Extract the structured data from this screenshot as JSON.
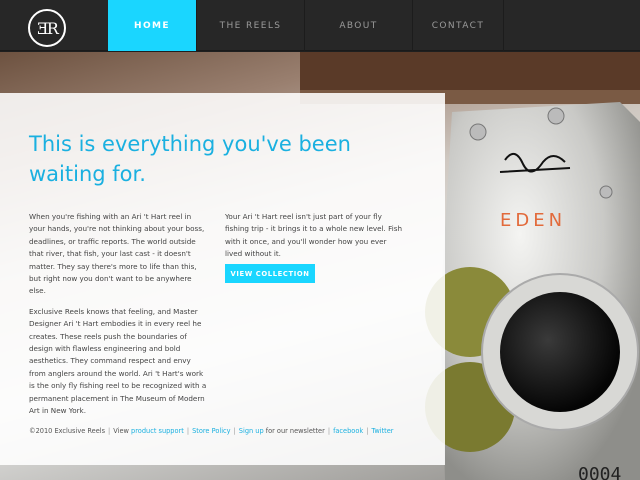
{
  "brand": {
    "logo_text": "ƎR"
  },
  "nav": {
    "items": [
      {
        "label": "HOME"
      },
      {
        "label": "THE REELS"
      },
      {
        "label": "ABOUT"
      },
      {
        "label": "CONTACT"
      }
    ]
  },
  "hero": {
    "headline": "This is everything you've been waiting for.",
    "left_paragraphs": [
      "When you're fishing with an Ari 't Hart reel in your hands, you're not thinking about your boss, deadlines, or traffic reports. The world outside that river, that fish, your last cast - it doesn't matter. They say there's more to life than this, but right now you don't want to be anywhere else.",
      "Exclusive Reels knows that feeling, and Master Designer Ari 't Hart embodies it in every reel he creates. These reels push the boundaries of design with flawless engineering and bold aesthetics. They command respect and envy from anglers around the world. Ari 't Hart's work is the only fly fishing reel to be recognized with a permanent placement in The Museum of Modern Art in New York."
    ],
    "right_paragraph": "Your Ari 't Hart reel isn't just part of your fly fishing trip - it brings it to a whole new level. Fish with it once, and you'll wonder how you ever lived without it.",
    "cta_label": "VIEW COLLECTION"
  },
  "reel_image": {
    "engraving": "EDEN",
    "serial": "0004"
  },
  "footer": {
    "copyright": "©2010 Exclusive Reels",
    "view_text": "View",
    "product_support": "product support",
    "store_policy": "Store Policy",
    "sign_up": "Sign up",
    "newsletter_text": "for our newsletter",
    "facebook": "facebook",
    "twitter": "Twitter",
    "separator": "|"
  },
  "colors": {
    "accent": "#1ad6ff",
    "headline": "#1ab0e0",
    "nav_bg": "#272727"
  }
}
